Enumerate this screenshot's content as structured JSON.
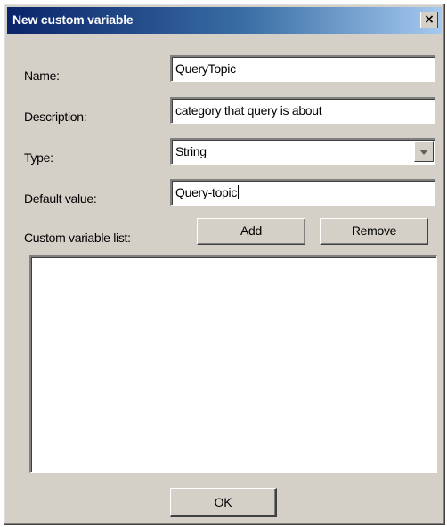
{
  "window": {
    "title": "New custom variable",
    "close_glyph": "×"
  },
  "form": {
    "name": {
      "label": "Name:",
      "value": "QueryTopic"
    },
    "description": {
      "label": "Description:",
      "value": "category that query is about"
    },
    "type": {
      "label": "Type:",
      "value": "String"
    },
    "default_value": {
      "label": "Default value:",
      "value": "Query-topic"
    }
  },
  "list": {
    "label": "Custom variable list:",
    "add_label": "Add",
    "remove_label": "Remove",
    "items": []
  },
  "footer": {
    "ok_label": "OK"
  },
  "icons": {
    "close": "close-icon",
    "dropdown": "chevron-down-icon"
  }
}
